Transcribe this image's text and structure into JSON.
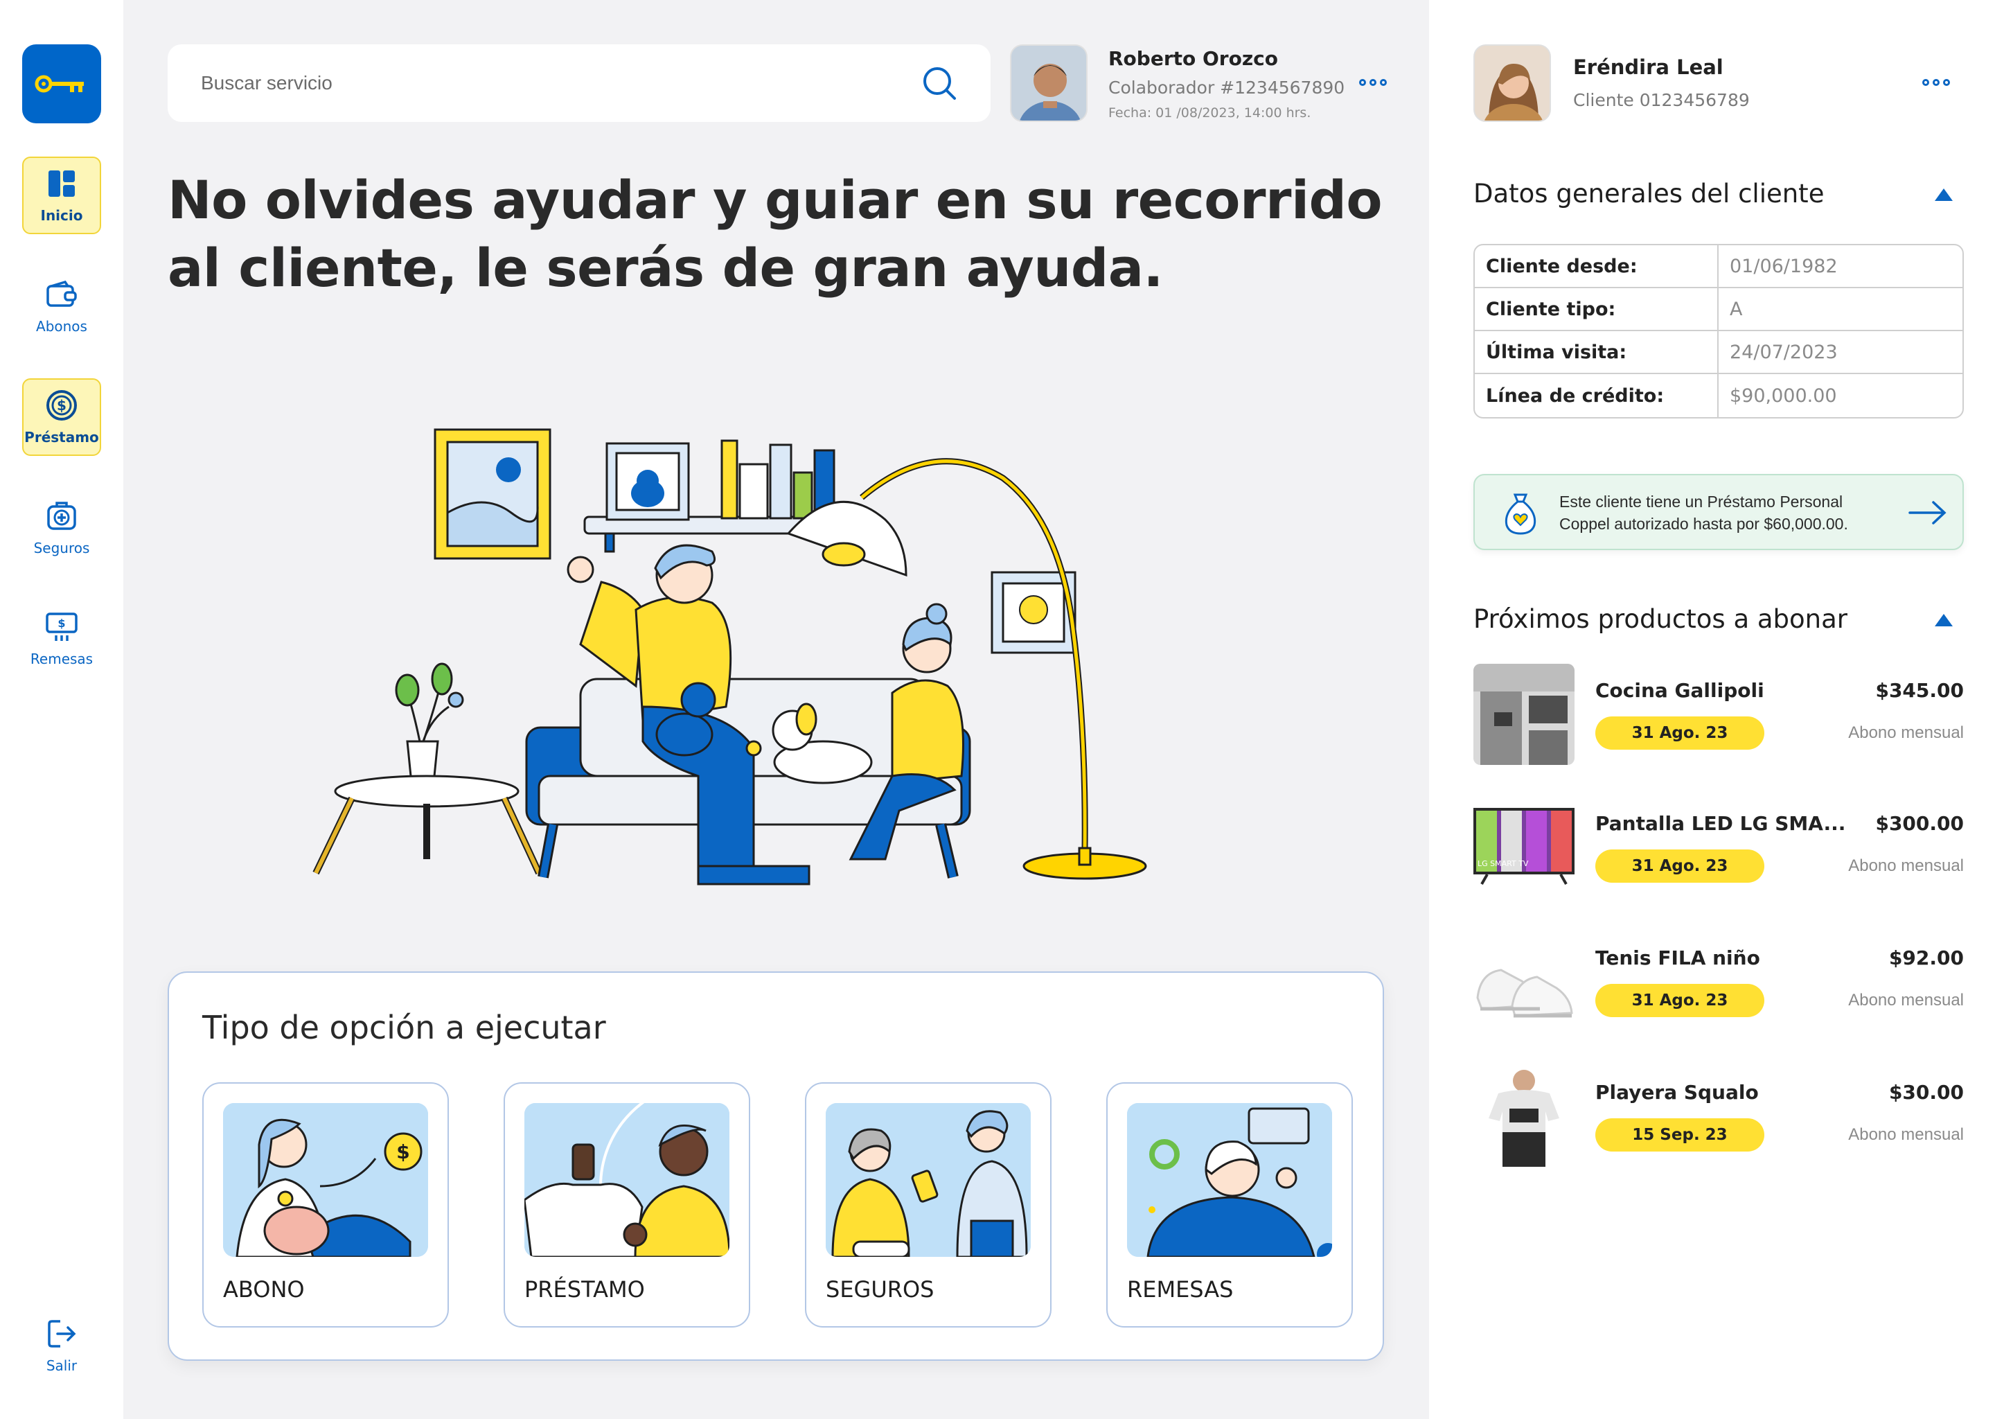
{
  "sidebar": {
    "logo_icon": "key-icon",
    "items": [
      {
        "label": "Inicio",
        "icon": "dashboard-icon",
        "active": true
      },
      {
        "label": "Abonos",
        "icon": "wallet-icon",
        "active": false
      },
      {
        "label": "Préstamo",
        "icon": "dollar-coin-icon",
        "active": true
      },
      {
        "label": "Seguros",
        "icon": "medical-case-icon",
        "active": false
      },
      {
        "label": "Remesas",
        "icon": "money-transfer-icon",
        "active": false
      }
    ],
    "logout_label": "Salir"
  },
  "search": {
    "placeholder": "Buscar servicio"
  },
  "collaborator": {
    "name": "Roberto Orozco",
    "id": "Colaborador #1234567890",
    "date": "Fecha: 01 /08/2023, 14:00 hrs."
  },
  "headline": "No olvides ayudar y guiar en su recorrido al cliente, le serás de gran ayuda.",
  "options": {
    "title": "Tipo de opción a ejecutar",
    "items": [
      {
        "label": "ABONO"
      },
      {
        "label": "PRÉSTAMO"
      },
      {
        "label": "SEGUROS"
      },
      {
        "label": "REMESAS"
      }
    ]
  },
  "client": {
    "name": "Eréndira Leal",
    "id": "Cliente 0123456789"
  },
  "general": {
    "title": "Datos generales del cliente",
    "rows": [
      {
        "key": "Cliente desde:",
        "value": "01/06/1982"
      },
      {
        "key": "Cliente tipo:",
        "value": "A"
      },
      {
        "key": "Última visita:",
        "value": "24/07/2023"
      },
      {
        "key": "Línea de crédito:",
        "value": "$90,000.00"
      }
    ]
  },
  "banner": {
    "text": "Este cliente tiene un Préstamo Personal Coppel autorizado hasta por $60,000.00."
  },
  "upcoming": {
    "title": "Próximos productos a abonar",
    "items": [
      {
        "name": "Cocina Gallipoli",
        "price": "$345.00",
        "date": "31 Ago. 23",
        "frequency": "Abono mensual"
      },
      {
        "name": "Pantalla LED LG SMA...",
        "price": "$300.00",
        "date": "31 Ago. 23",
        "frequency": "Abono mensual",
        "thumb_text": "LG SMART TV"
      },
      {
        "name": "Tenis FILA niño",
        "price": "$92.00",
        "date": "31 Ago. 23",
        "frequency": "Abono mensual"
      },
      {
        "name": "Playera Squalo",
        "price": "$30.00",
        "date": "15 Sep. 23",
        "frequency": "Abono mensual"
      }
    ]
  },
  "colors": {
    "primary_blue": "#0066c9",
    "accent_yellow": "#ffe033",
    "active_bg": "#fdf6b8",
    "banner_green": "#e9f6ee"
  }
}
